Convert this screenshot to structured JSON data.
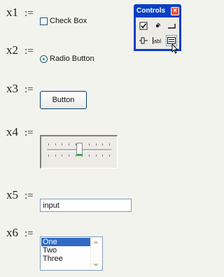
{
  "variables": [
    {
      "name": "x1",
      "op": ":="
    },
    {
      "name": "x2",
      "op": ":="
    },
    {
      "name": "x3",
      "op": ":="
    },
    {
      "name": "x4",
      "op": ":="
    },
    {
      "name": "x5",
      "op": ":="
    },
    {
      "name": "x6",
      "op": ":="
    }
  ],
  "checkbox": {
    "label": "Check Box",
    "checked": false
  },
  "radio": {
    "label": "Radio Button",
    "selected": true
  },
  "button": {
    "label": "Button"
  },
  "slider": {
    "value_fraction": 0.5,
    "tick_count": 10
  },
  "text_input": {
    "value": "input"
  },
  "listbox": {
    "items": [
      "One",
      "Two",
      "Three"
    ],
    "selected_index": 0
  },
  "controls_toolbar": {
    "title": "Controls",
    "close_glyph": "×",
    "tools": [
      "checkbox-tool-icon",
      "radio-button-tool-icon",
      "push-button-tool-icon",
      "slider-tool-icon",
      "textbox-tool-icon",
      "listbox-tool-icon"
    ]
  }
}
